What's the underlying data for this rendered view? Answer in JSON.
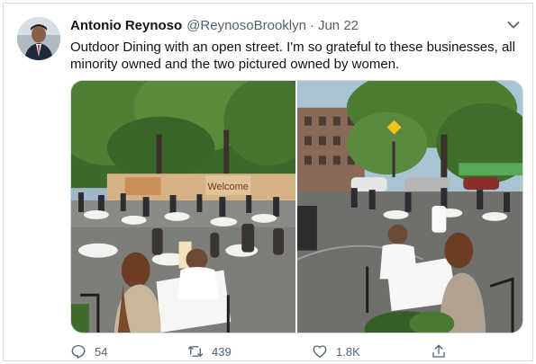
{
  "tweet": {
    "author_name": "Antonio Reynoso",
    "handle": "@ReynosoBrooklyn",
    "separator": "·",
    "date": "Jun 22",
    "text": "Outdoor Dining with an open street. I'm so grateful to these businesses, all minority owned and the two pictured owned by women.",
    "photo_left_sign": "Welcome"
  },
  "actions": {
    "reply_count": "54",
    "retweet_count": "439",
    "like_count": "1.8K"
  },
  "icons": {
    "reply": "reply-icon",
    "retweet": "retweet-icon",
    "like": "heart-icon",
    "share": "share-icon",
    "menu": "chevron-down-icon"
  },
  "colors": {
    "text_primary": "#0f1419",
    "text_secondary": "#536471",
    "border": "#cfd9de"
  }
}
